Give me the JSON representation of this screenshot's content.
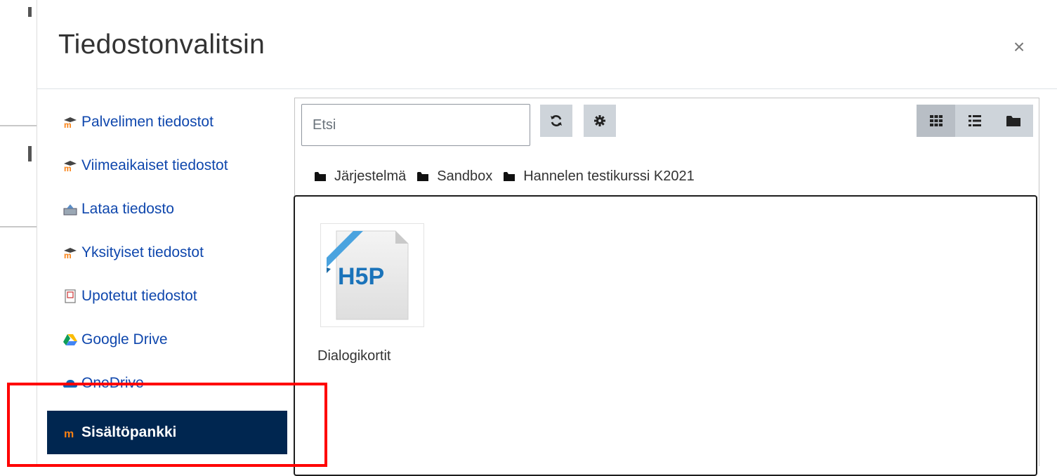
{
  "dialog": {
    "title": "Tiedostonvalitsin",
    "close_glyph": "×"
  },
  "sidebar": {
    "items": [
      {
        "label": "Palvelimen tiedostot",
        "icon": "moodle-icon"
      },
      {
        "label": "Viimeaikaiset tiedostot",
        "icon": "moodle-icon"
      },
      {
        "label": "Lataa tiedosto",
        "icon": "upload-icon"
      },
      {
        "label": "Yksityiset tiedostot",
        "icon": "moodle-icon"
      },
      {
        "label": "Upotetut tiedostot",
        "icon": "embedded-file-icon"
      },
      {
        "label": "Google Drive",
        "icon": "google-drive-icon"
      },
      {
        "label": "OneDrive",
        "icon": "onedrive-icon"
      },
      {
        "label": "Sisältöpankki",
        "icon": "content-bank-icon",
        "active": true
      }
    ]
  },
  "toolbar": {
    "search_placeholder": "Etsi",
    "refresh_icon": "refresh-icon",
    "settings_icon": "gear-icon",
    "view_modes": [
      "grid-view-icon",
      "list-view-icon",
      "folder-view-icon"
    ]
  },
  "breadcrumb": {
    "items": [
      "Järjestelmä",
      "Sandbox",
      "Hannelen testikurssi K2021"
    ]
  },
  "files": [
    {
      "name": "Dialogikortit",
      "thumbnail_text": "H5P"
    }
  ],
  "colors": {
    "link": "#0f47ad",
    "active_bg": "#002650",
    "toolbar_bg": "#ced4da",
    "highlight": "#ff0000",
    "h5p_blue": "#1a73ba"
  }
}
